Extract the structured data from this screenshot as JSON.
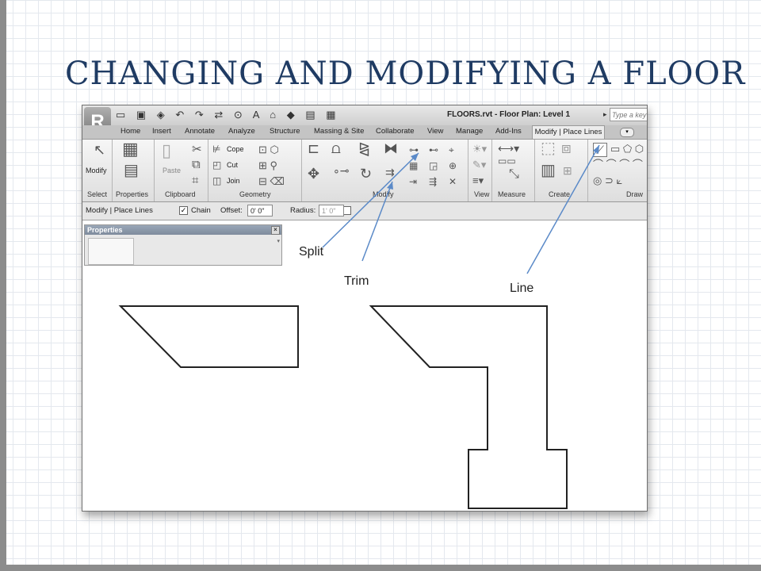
{
  "slide": {
    "title": "CHANGING AND  MODIFYING A FLOOR"
  },
  "titlebar": {
    "window_title": "FLOORS.rvt - Floor Plan: Level 1",
    "search_placeholder": "Type a key"
  },
  "tabs": [
    "Home",
    "Insert",
    "Annotate",
    "Analyze",
    "Structure",
    "Massing & Site",
    "Collaborate",
    "View",
    "Manage",
    "Add-Ins"
  ],
  "active_tab": "Modify | Place Lines",
  "ribbon": {
    "modify_label": "Modify",
    "paste_label": "Paste",
    "cope_label": "Cope",
    "cut_label": "Cut",
    "join_label": "Join",
    "panels": {
      "select": "Select",
      "properties": "Properties",
      "clipboard": "Clipboard",
      "geometry": "Geometry",
      "modify": "Modify",
      "view": "View",
      "measure": "Measure",
      "create": "Create",
      "draw": "Draw"
    }
  },
  "options_bar": {
    "context": "Modify | Place Lines",
    "chain_label": "Chain",
    "chain_checked": "✓",
    "offset_label": "Offset:",
    "offset_value": "0'  0\"",
    "radius_label": "Radius:",
    "radius_value": "1'  0\""
  },
  "properties_palette": {
    "title": "Properties",
    "close_glyph": "×"
  },
  "callouts": {
    "split": "Split",
    "trim": "Trim",
    "line": "Line"
  },
  "colors": {
    "title": "#1f3b63",
    "arrow": "#5b8ac8",
    "grid": "#e4e8ee"
  }
}
